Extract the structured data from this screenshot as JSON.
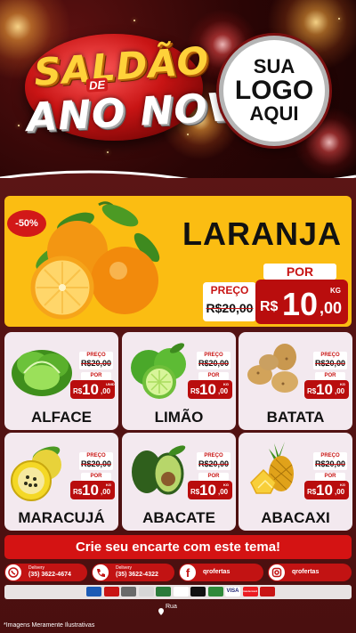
{
  "colors": {
    "brand_red": "#c81515",
    "featured_bg": "#fbbd12",
    "card_bg": "#f3e9ef"
  },
  "header": {
    "title_line1": "SALDÃO",
    "title_connector": "DE",
    "title_line2": "ANO NOVO",
    "logo_line1": "SUA",
    "logo_line2": "LOGO",
    "logo_line3": "AQUI"
  },
  "featured": {
    "discount": "-50%",
    "name": "LARANJA",
    "preco_label": "PREÇO",
    "old_price": "R$20,00",
    "por_label": "POR",
    "currency": "R$",
    "price_int": "10",
    "price_cents": ",00",
    "unit": "KG",
    "image": "orange-fruit-image"
  },
  "products": [
    {
      "name": "ALFACE",
      "preco_label": "PREÇO",
      "old_price": "R$20,00",
      "por_label": "POR",
      "currency": "R$",
      "price_int": "10",
      "price_cents": ",00",
      "unit": "UNID",
      "image": "lettuce-image"
    },
    {
      "name": "LIMÃO",
      "preco_label": "PREÇO",
      "old_price": "R$20,00",
      "por_label": "POR",
      "currency": "R$",
      "price_int": "10",
      "price_cents": ",00",
      "unit": "KG",
      "image": "lime-image"
    },
    {
      "name": "BATATA",
      "preco_label": "PREÇO",
      "old_price": "R$20,00",
      "por_label": "POR",
      "currency": "R$",
      "price_int": "10",
      "price_cents": ",00",
      "unit": "KG",
      "image": "potato-image"
    },
    {
      "name": "MARACUJÁ",
      "preco_label": "PREÇO",
      "old_price": "R$20,00",
      "por_label": "POR",
      "currency": "R$",
      "price_int": "10",
      "price_cents": ",00",
      "unit": "KG",
      "image": "passion-fruit-image"
    },
    {
      "name": "ABACATE",
      "preco_label": "PREÇO",
      "old_price": "R$20,00",
      "por_label": "POR",
      "currency": "R$",
      "price_int": "10",
      "price_cents": ",00",
      "unit": "KG",
      "image": "avocado-image"
    },
    {
      "name": "ABACAXI",
      "preco_label": "PREÇO",
      "old_price": "R$20,00",
      "por_label": "POR",
      "currency": "R$",
      "price_int": "10",
      "price_cents": ",00",
      "unit": "KG",
      "image": "pineapple-image"
    }
  ],
  "banner": {
    "text": "Crie seu encarte com este tema!"
  },
  "contacts": {
    "whatsapp": {
      "label": "Delivery",
      "number": "(35) 3622-4674",
      "icon": "whatsapp-icon"
    },
    "phone": {
      "label": "Delivery",
      "number": "(35) 3622-4322",
      "icon": "phone-icon"
    },
    "facebook": {
      "handle": "qrofertas",
      "icon": "facebook-icon"
    },
    "instagram": {
      "handle": "qrofertas",
      "icon": "instagram-icon"
    }
  },
  "payments": [
    "card-logo",
    "card-logo",
    "card-logo",
    "card-logo",
    "card-logo",
    "card-logo",
    "card-logo",
    "card-logo",
    "VISA",
    "mastercard",
    "card-logo"
  ],
  "address": "Rua",
  "disclaimer": "*Imagens Meramente Ilustrativas"
}
